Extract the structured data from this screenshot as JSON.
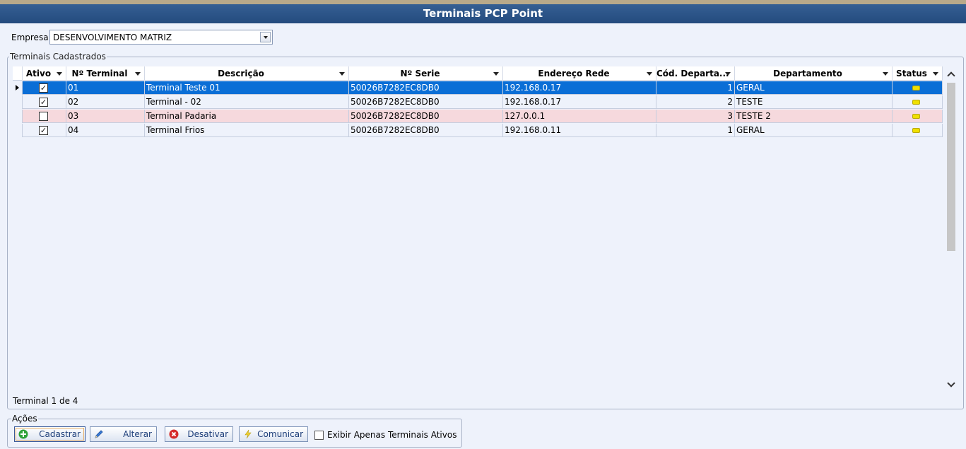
{
  "window": {
    "title": "Terminais PCP Point"
  },
  "empresa": {
    "label": "Empresa",
    "value": "DESENVOLVIMENTO MATRIZ"
  },
  "terminais": {
    "legend": "Terminais Cadastrados",
    "columns": [
      {
        "key": "ativo",
        "label": "Ativo"
      },
      {
        "key": "numero",
        "label": "Nº Terminal"
      },
      {
        "key": "descricao",
        "label": "Descrição"
      },
      {
        "key": "serie",
        "label": "Nº Serie"
      },
      {
        "key": "endereco",
        "label": "Endereço Rede"
      },
      {
        "key": "cod_depto",
        "label": "Cód. Departa..."
      },
      {
        "key": "departamento",
        "label": "Departamento"
      },
      {
        "key": "status",
        "label": "Status"
      }
    ],
    "rows": [
      {
        "ativo": true,
        "numero": "01",
        "descricao": "Terminal Teste 01",
        "serie": "50026B7282EC8DB0",
        "endereco": "192.168.0.17",
        "cod_depto": "1",
        "departamento": "GERAL",
        "status_color": "#f0e000",
        "selected": true
      },
      {
        "ativo": true,
        "numero": "02",
        "descricao": "Terminal - 02",
        "serie": "50026B7282EC8DB0",
        "endereco": "192.168.0.17",
        "cod_depto": "2",
        "departamento": "TESTE",
        "status_color": "#f0e000",
        "selected": false
      },
      {
        "ativo": false,
        "numero": "03",
        "descricao": "Terminal Padaria",
        "serie": "50026B7282EC8DB0",
        "endereco": "127.0.0.1",
        "cod_depto": "3",
        "departamento": "TESTE 2",
        "status_color": "#f0e000",
        "selected": false
      },
      {
        "ativo": true,
        "numero": "04",
        "descricao": "Terminal Frios",
        "serie": "50026B7282EC8DB0",
        "endereco": "192.168.0.11",
        "cod_depto": "1",
        "departamento": "GERAL",
        "status_color": "#f0e000",
        "selected": false
      }
    ],
    "footer": "Terminal 1 de 4"
  },
  "acoes": {
    "legend": "Ações",
    "cadastrar": "Cadastrar",
    "alterar": "Alterar",
    "desativar": "Desativar",
    "comunicar": "Comunicar",
    "exibir_ativos_label": "Exibir Apenas Terminais Ativos",
    "exibir_ativos_checked": false
  },
  "colors": {
    "title_bar": "#2c5588",
    "selected_row": "#0a6ed6",
    "inactive_row": "#f6d9dd",
    "background": "#eef2fb"
  }
}
